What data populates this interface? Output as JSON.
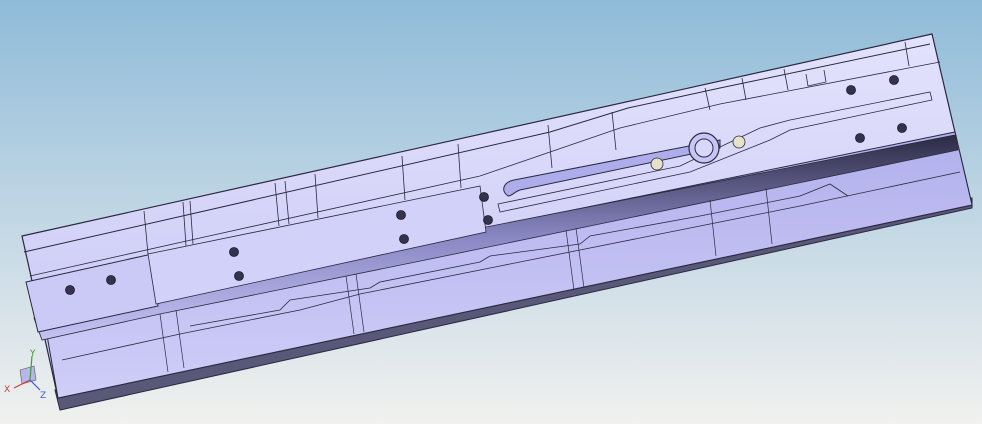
{
  "viewport": {
    "background_top": "#8fbbd9",
    "background_bottom": "#f1f1ef"
  },
  "model": {
    "body_color": "#c9c8f6",
    "face_light": "#d9d8fb",
    "face_mid": "#b9b7ee",
    "face_dark": "#5f5d8c",
    "edge_color": "#2a2940",
    "hole_color": "#34324c",
    "pin_color": "#e6e1c8"
  },
  "triad": {
    "x_label": "X",
    "y_label": "Y",
    "z_label": "Z",
    "x_color": "#c94040",
    "y_color": "#3e9a3e",
    "z_color": "#3d5bd6"
  }
}
